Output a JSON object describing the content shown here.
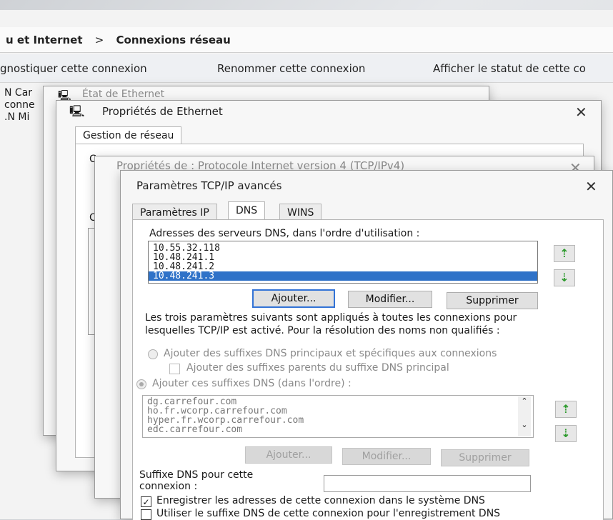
{
  "explorer": {
    "breadcrumb": [
      "u et Internet",
      "Connexions réseau"
    ],
    "breadcrumb_sep": ">",
    "commands": [
      "gnostiquer cette connexion",
      "Renommer cette connexion",
      "Afficher le statut de cette co"
    ],
    "network_items": [
      "N Car",
      "conne",
      ".N Mi"
    ]
  },
  "dialog_status": {
    "title": "État de Ethernet"
  },
  "dialog_props": {
    "title": "Propriétés de Ethernet",
    "tab": "Gestion de réseau",
    "label_connect": "Co",
    "label_this": "Ce"
  },
  "dialog_ipv4": {
    "title": "Propriétés de : Protocole Internet version 4 (TCP/IPv4)"
  },
  "dialog_adv": {
    "title": "Paramètres TCP/IP avancés",
    "tabs": [
      "Paramètres IP",
      "DNS",
      "WINS"
    ],
    "dns_servers_label": "Adresses des serveurs DNS, dans l'ordre d'utilisation :",
    "dns_servers": [
      "10.55.32.118",
      "10.48.241.1",
      "10.48.241.2",
      "10.48.241.3"
    ],
    "selected_server_index": 3,
    "buttons_top": [
      "Ajouter...",
      "Modifier...",
      "Supprimer"
    ],
    "info_line1": "Les trois paramètres suivants sont appliqués à toutes les connexions pour",
    "info_line2": "lesquelles TCP/IP est activé. Pour la résolution des noms non qualifiés :",
    "radio1": "Ajouter des suffixes DNS principaux et spécifiques aux connexions",
    "check_parent": "Ajouter des suffixes parents du suffixe DNS principal",
    "radio2": "Ajouter ces suffixes DNS (dans l'ordre) :",
    "suffixes": [
      "dg.carrefour.com",
      "ho.fr.wcorp.carrefour.com",
      "hyper.fr.wcorp.carrefour.com",
      "edc.carrefour.com"
    ],
    "buttons_bottom": [
      "Ajouter...",
      "Modifier...",
      "Supprimer"
    ],
    "suffix_label_1": "Suffixe DNS pour cette",
    "suffix_label_2": "connexion :",
    "suffix_value": "",
    "check_register": "Enregistrer les adresses de cette connexion dans le système DNS",
    "check_use_suffix": "Utiliser le suffixe DNS de cette connexion pour l'enregistrement DNS",
    "up_arrow": "⇡",
    "down_arrow": "⇣",
    "close_glyph": "✕"
  }
}
